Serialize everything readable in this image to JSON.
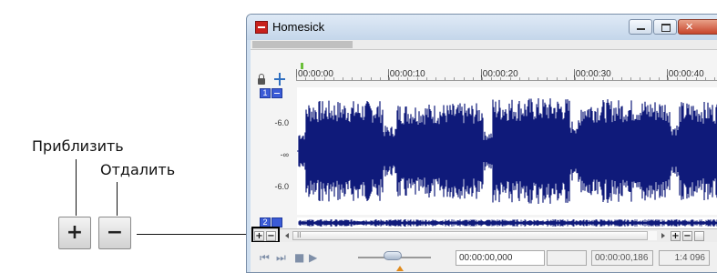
{
  "annotations": {
    "zoom_in_label": "Приблизить",
    "zoom_out_label": "Отдалить"
  },
  "callout_buttons": {
    "zoom_in_glyph": "+",
    "zoom_out_glyph": "−"
  },
  "window": {
    "title": "Homesick",
    "minimize_glyph": "–",
    "maximize_glyph": "□",
    "close_glyph": "✕"
  },
  "ruler": {
    "ticks": [
      "00:00:00",
      ",00:00:10",
      ",00:00:20",
      ",00:00:30",
      ",00:00:40"
    ]
  },
  "tracks": {
    "track1_number": "1",
    "track2_number": "2",
    "db_labels": [
      "-6.0",
      "-∞",
      "-6.0"
    ]
  },
  "scroll": {
    "zoom_in": "+",
    "zoom_out": "−",
    "thumb": "II"
  },
  "transport": {
    "cursor_time": "00:00:00,000",
    "selection_end": "00:00:00,186",
    "zoom_ratio": "1:4 096"
  },
  "colors": {
    "waveform": "#0f1a7a",
    "track_button": "#3b5bd6"
  }
}
